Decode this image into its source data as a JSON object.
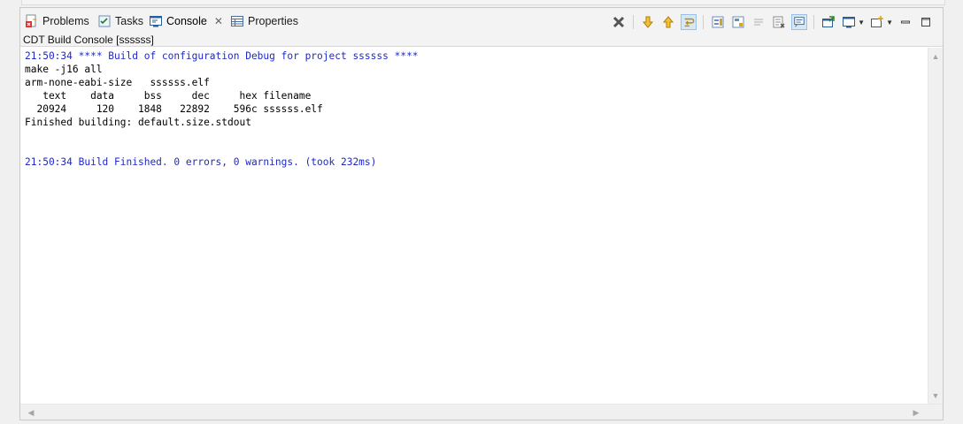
{
  "tabs": [
    {
      "label": "Problems",
      "icon": "problems-icon"
    },
    {
      "label": "Tasks",
      "icon": "tasks-icon"
    },
    {
      "label": "Console",
      "icon": "console-icon",
      "active": true
    },
    {
      "label": "Properties",
      "icon": "properties-icon"
    }
  ],
  "console": {
    "title": "CDT Build Console [ssssss]",
    "lines": [
      {
        "text": "21:50:34 **** Build of configuration Debug for project ssssss ****",
        "color": "#1e28c8"
      },
      {
        "text": "make -j16 all",
        "color": "#000000"
      },
      {
        "text": "arm-none-eabi-size   ssssss.elf",
        "color": "#000000"
      },
      {
        "text": "   text    data     bss     dec     hex filename",
        "color": "#000000"
      },
      {
        "text": "  20924     120    1848   22892    596c ssssss.elf",
        "color": "#000000"
      },
      {
        "text": "Finished building: default.size.stdout",
        "color": "#000000"
      },
      {
        "text": " ",
        "color": "#000000"
      },
      {
        "text": " ",
        "color": "#000000"
      },
      {
        "text": "21:50:34 Build Finished. 0 errors, 0 warnings. (took 232ms)",
        "color": "#1e28c8"
      }
    ]
  },
  "toolbar": [
    "clear-console-icon",
    "scroll-up-icon",
    "scroll-down-icon",
    "word-wrap-icon",
    "scroll-lock-icon",
    "show-on-output-icon",
    "pin-console-icon",
    "open-console-icon",
    "display-console-icon",
    "minimize-icon",
    "maximize-icon"
  ]
}
